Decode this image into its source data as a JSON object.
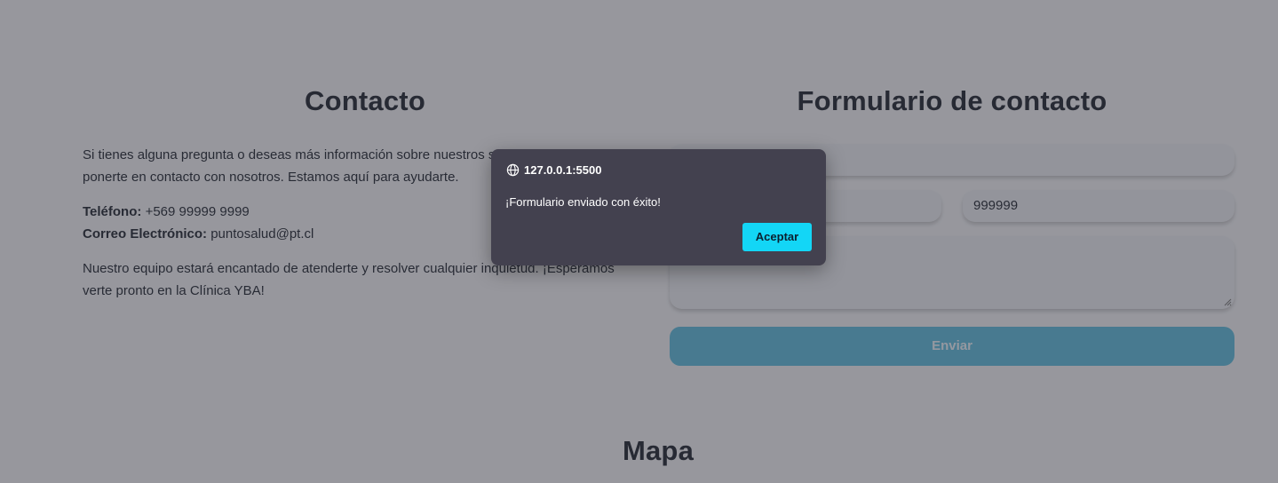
{
  "contact": {
    "title": "Contacto",
    "intro_line1": "Si tienes alguna pregunta o deseas más información sobre nuestros servicios, no dudes en",
    "intro_line2": "ponerte en contacto con nosotros. Estamos aquí para ayudarte.",
    "phone_label": "Teléfono:",
    "phone_value": "+569 99999 9999",
    "email_label": "Correo Electrónico:",
    "email_value": "puntosalud@pt.cl",
    "closing_line1": "Nuestro equipo estará encantado de atenderte y resolver cualquier inquietud. ¡Esperamos",
    "closing_line2": "verte pronto en la Clínica YBA!"
  },
  "form": {
    "title": "Formulario de contacto",
    "phone_value": "999999",
    "submit_label": "Enviar",
    "accent_color": "#5fbfe0"
  },
  "map": {
    "title": "Mapa"
  },
  "dialog": {
    "origin": "127.0.0.1:5500",
    "origin_icon": "globe-icon",
    "message": "¡Formulario enviado con éxito!",
    "accept_label": "Aceptar",
    "accept_color": "#13d6f6"
  }
}
